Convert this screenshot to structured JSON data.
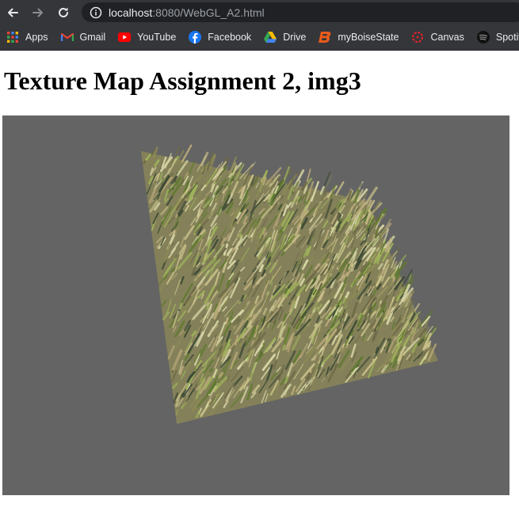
{
  "browser": {
    "url_host": "localhost",
    "url_path": ":8080/WebGL_A2.html",
    "bookmarks": [
      {
        "label": "Apps",
        "icon": "apps-grid-icon"
      },
      {
        "label": "Gmail",
        "icon": "gmail-icon"
      },
      {
        "label": "YouTube",
        "icon": "youtube-icon"
      },
      {
        "label": "Facebook",
        "icon": "facebook-icon"
      },
      {
        "label": "Drive",
        "icon": "drive-icon"
      },
      {
        "label": "myBoiseState",
        "icon": "boise-state-icon"
      },
      {
        "label": "Canvas",
        "icon": "canvas-icon"
      },
      {
        "label": "Spotify Ar",
        "icon": "spotify-icon"
      }
    ]
  },
  "page": {
    "title": "Texture Map Assignment 2, img3"
  },
  "canvas": {
    "background": "#646464",
    "texture_colors": [
      "#c9c08a",
      "#8c8a55",
      "#5f7a2e",
      "#9fb35a",
      "#d8d7a8",
      "#3d4a35",
      "#b9a97a",
      "#6e6a48"
    ]
  }
}
